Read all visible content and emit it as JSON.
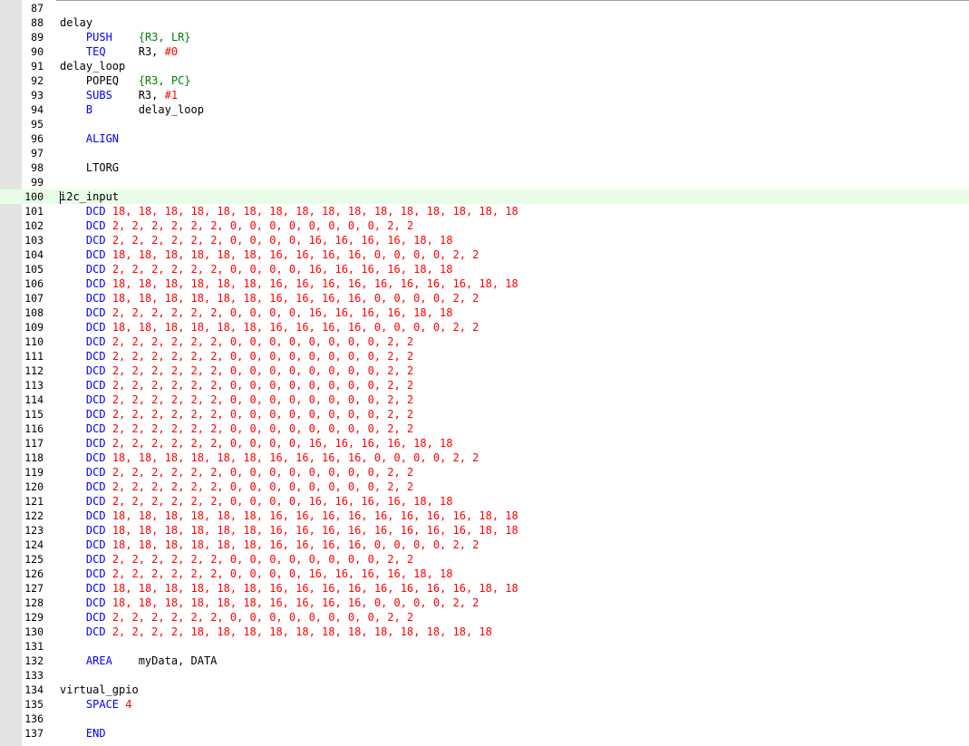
{
  "editor": {
    "current_line": 100,
    "colors": {
      "instruction": "#0000ff",
      "register": "#008000",
      "number": "#ff0000",
      "label": "#000000",
      "current_line_bg": "#e8fce8"
    },
    "lines": [
      {
        "n": "87",
        "tokens": []
      },
      {
        "n": "88",
        "tokens": [
          {
            "t": "label",
            "v": "delay"
          }
        ]
      },
      {
        "n": "89",
        "tokens": [
          {
            "t": "text",
            "v": "    "
          },
          {
            "t": "instr",
            "v": "PUSH"
          },
          {
            "t": "text",
            "v": "    "
          },
          {
            "t": "reg",
            "v": "{R3, LR}"
          }
        ]
      },
      {
        "n": "90",
        "tokens": [
          {
            "t": "text",
            "v": "    "
          },
          {
            "t": "instr",
            "v": "TEQ"
          },
          {
            "t": "text",
            "v": "     R3, "
          },
          {
            "t": "num",
            "v": "#0"
          }
        ]
      },
      {
        "n": "91",
        "tokens": [
          {
            "t": "label",
            "v": "delay_loop"
          }
        ]
      },
      {
        "n": "92",
        "tokens": [
          {
            "t": "text",
            "v": "    POPEQ   "
          },
          {
            "t": "reg",
            "v": "{R3, PC}"
          }
        ]
      },
      {
        "n": "93",
        "tokens": [
          {
            "t": "text",
            "v": "    "
          },
          {
            "t": "instr",
            "v": "SUBS"
          },
          {
            "t": "text",
            "v": "    R3, "
          },
          {
            "t": "num",
            "v": "#1"
          }
        ]
      },
      {
        "n": "94",
        "tokens": [
          {
            "t": "text",
            "v": "    "
          },
          {
            "t": "instr",
            "v": "B"
          },
          {
            "t": "text",
            "v": "       delay_loop"
          }
        ]
      },
      {
        "n": "95",
        "tokens": []
      },
      {
        "n": "96",
        "tokens": [
          {
            "t": "text",
            "v": "    "
          },
          {
            "t": "instr",
            "v": "ALIGN"
          }
        ]
      },
      {
        "n": "97",
        "tokens": []
      },
      {
        "n": "98",
        "tokens": [
          {
            "t": "text",
            "v": "    LTORG"
          }
        ]
      },
      {
        "n": "99",
        "tokens": []
      },
      {
        "n": "100",
        "tokens": [
          {
            "t": "label",
            "v": "i2c_input"
          }
        ]
      },
      {
        "n": "101",
        "tokens": [
          {
            "t": "text",
            "v": "    "
          },
          {
            "t": "instr",
            "v": "DCD"
          },
          {
            "t": "text",
            "v": " "
          },
          {
            "t": "num",
            "v": "18, 18, 18, 18, 18, 18, 18, 18, 18, 18, 18, 18, 18, 18, 18, 18"
          }
        ]
      },
      {
        "n": "102",
        "tokens": [
          {
            "t": "text",
            "v": "    "
          },
          {
            "t": "instr",
            "v": "DCD"
          },
          {
            "t": "text",
            "v": " "
          },
          {
            "t": "num",
            "v": "2, 2, 2, 2, 2, 2, 0, 0, 0, 0, 0, 0, 0, 0, 2, 2"
          }
        ]
      },
      {
        "n": "103",
        "tokens": [
          {
            "t": "text",
            "v": "    "
          },
          {
            "t": "instr",
            "v": "DCD"
          },
          {
            "t": "text",
            "v": " "
          },
          {
            "t": "num",
            "v": "2, 2, 2, 2, 2, 2, 0, 0, 0, 0, 16, 16, 16, 16, 18, 18"
          }
        ]
      },
      {
        "n": "104",
        "tokens": [
          {
            "t": "text",
            "v": "    "
          },
          {
            "t": "instr",
            "v": "DCD"
          },
          {
            "t": "text",
            "v": " "
          },
          {
            "t": "num",
            "v": "18, 18, 18, 18, 18, 18, 16, 16, 16, 16, 0, 0, 0, 0, 2, 2"
          }
        ]
      },
      {
        "n": "105",
        "tokens": [
          {
            "t": "text",
            "v": "    "
          },
          {
            "t": "instr",
            "v": "DCD"
          },
          {
            "t": "text",
            "v": " "
          },
          {
            "t": "num",
            "v": "2, 2, 2, 2, 2, 2, 0, 0, 0, 0, 16, 16, 16, 16, 18, 18"
          }
        ]
      },
      {
        "n": "106",
        "tokens": [
          {
            "t": "text",
            "v": "    "
          },
          {
            "t": "instr",
            "v": "DCD"
          },
          {
            "t": "text",
            "v": " "
          },
          {
            "t": "num",
            "v": "18, 18, 18, 18, 18, 18, 16, 16, 16, 16, 16, 16, 16, 16, 18, 18"
          }
        ]
      },
      {
        "n": "107",
        "tokens": [
          {
            "t": "text",
            "v": "    "
          },
          {
            "t": "instr",
            "v": "DCD"
          },
          {
            "t": "text",
            "v": " "
          },
          {
            "t": "num",
            "v": "18, 18, 18, 18, 18, 18, 16, 16, 16, 16, 0, 0, 0, 0, 2, 2"
          }
        ]
      },
      {
        "n": "108",
        "tokens": [
          {
            "t": "text",
            "v": "    "
          },
          {
            "t": "instr",
            "v": "DCD"
          },
          {
            "t": "text",
            "v": " "
          },
          {
            "t": "num",
            "v": "2, 2, 2, 2, 2, 2, 0, 0, 0, 0, 16, 16, 16, 16, 18, 18"
          }
        ]
      },
      {
        "n": "109",
        "tokens": [
          {
            "t": "text",
            "v": "    "
          },
          {
            "t": "instr",
            "v": "DCD"
          },
          {
            "t": "text",
            "v": " "
          },
          {
            "t": "num",
            "v": "18, 18, 18, 18, 18, 18, 16, 16, 16, 16, 0, 0, 0, 0, 2, 2"
          }
        ]
      },
      {
        "n": "110",
        "tokens": [
          {
            "t": "text",
            "v": "    "
          },
          {
            "t": "instr",
            "v": "DCD"
          },
          {
            "t": "text",
            "v": " "
          },
          {
            "t": "num",
            "v": "2, 2, 2, 2, 2, 2, 0, 0, 0, 0, 0, 0, 0, 0, 2, 2"
          }
        ]
      },
      {
        "n": "111",
        "tokens": [
          {
            "t": "text",
            "v": "    "
          },
          {
            "t": "instr",
            "v": "DCD"
          },
          {
            "t": "text",
            "v": " "
          },
          {
            "t": "num",
            "v": "2, 2, 2, 2, 2, 2, 0, 0, 0, 0, 0, 0, 0, 0, 2, 2"
          }
        ]
      },
      {
        "n": "112",
        "tokens": [
          {
            "t": "text",
            "v": "    "
          },
          {
            "t": "instr",
            "v": "DCD"
          },
          {
            "t": "text",
            "v": " "
          },
          {
            "t": "num",
            "v": "2, 2, 2, 2, 2, 2, 0, 0, 0, 0, 0, 0, 0, 0, 2, 2"
          }
        ]
      },
      {
        "n": "113",
        "tokens": [
          {
            "t": "text",
            "v": "    "
          },
          {
            "t": "instr",
            "v": "DCD"
          },
          {
            "t": "text",
            "v": " "
          },
          {
            "t": "num",
            "v": "2, 2, 2, 2, 2, 2, 0, 0, 0, 0, 0, 0, 0, 0, 2, 2"
          }
        ]
      },
      {
        "n": "114",
        "tokens": [
          {
            "t": "text",
            "v": "    "
          },
          {
            "t": "instr",
            "v": "DCD"
          },
          {
            "t": "text",
            "v": " "
          },
          {
            "t": "num",
            "v": "2, 2, 2, 2, 2, 2, 0, 0, 0, 0, 0, 0, 0, 0, 2, 2"
          }
        ]
      },
      {
        "n": "115",
        "tokens": [
          {
            "t": "text",
            "v": "    "
          },
          {
            "t": "instr",
            "v": "DCD"
          },
          {
            "t": "text",
            "v": " "
          },
          {
            "t": "num",
            "v": "2, 2, 2, 2, 2, 2, 0, 0, 0, 0, 0, 0, 0, 0, 2, 2"
          }
        ]
      },
      {
        "n": "116",
        "tokens": [
          {
            "t": "text",
            "v": "    "
          },
          {
            "t": "instr",
            "v": "DCD"
          },
          {
            "t": "text",
            "v": " "
          },
          {
            "t": "num",
            "v": "2, 2, 2, 2, 2, 2, 0, 0, 0, 0, 0, 0, 0, 0, 2, 2"
          }
        ]
      },
      {
        "n": "117",
        "tokens": [
          {
            "t": "text",
            "v": "    "
          },
          {
            "t": "instr",
            "v": "DCD"
          },
          {
            "t": "text",
            "v": " "
          },
          {
            "t": "num",
            "v": "2, 2, 2, 2, 2, 2, 0, 0, 0, 0, 16, 16, 16, 16, 18, 18"
          }
        ]
      },
      {
        "n": "118",
        "tokens": [
          {
            "t": "text",
            "v": "    "
          },
          {
            "t": "instr",
            "v": "DCD"
          },
          {
            "t": "text",
            "v": " "
          },
          {
            "t": "num",
            "v": "18, 18, 18, 18, 18, 18, 16, 16, 16, 16, 0, 0, 0, 0, 2, 2"
          }
        ]
      },
      {
        "n": "119",
        "tokens": [
          {
            "t": "text",
            "v": "    "
          },
          {
            "t": "instr",
            "v": "DCD"
          },
          {
            "t": "text",
            "v": " "
          },
          {
            "t": "num",
            "v": "2, 2, 2, 2, 2, 2, 0, 0, 0, 0, 0, 0, 0, 0, 2, 2"
          }
        ]
      },
      {
        "n": "120",
        "tokens": [
          {
            "t": "text",
            "v": "    "
          },
          {
            "t": "instr",
            "v": "DCD"
          },
          {
            "t": "text",
            "v": " "
          },
          {
            "t": "num",
            "v": "2, 2, 2, 2, 2, 2, 0, 0, 0, 0, 0, 0, 0, 0, 2, 2"
          }
        ]
      },
      {
        "n": "121",
        "tokens": [
          {
            "t": "text",
            "v": "    "
          },
          {
            "t": "instr",
            "v": "DCD"
          },
          {
            "t": "text",
            "v": " "
          },
          {
            "t": "num",
            "v": "2, 2, 2, 2, 2, 2, 0, 0, 0, 0, 16, 16, 16, 16, 18, 18"
          }
        ]
      },
      {
        "n": "122",
        "tokens": [
          {
            "t": "text",
            "v": "    "
          },
          {
            "t": "instr",
            "v": "DCD"
          },
          {
            "t": "text",
            "v": " "
          },
          {
            "t": "num",
            "v": "18, 18, 18, 18, 18, 18, 16, 16, 16, 16, 16, 16, 16, 16, 18, 18"
          }
        ]
      },
      {
        "n": "123",
        "tokens": [
          {
            "t": "text",
            "v": "    "
          },
          {
            "t": "instr",
            "v": "DCD"
          },
          {
            "t": "text",
            "v": " "
          },
          {
            "t": "num",
            "v": "18, 18, 18, 18, 18, 18, 16, 16, 16, 16, 16, 16, 16, 16, 18, 18"
          }
        ]
      },
      {
        "n": "124",
        "tokens": [
          {
            "t": "text",
            "v": "    "
          },
          {
            "t": "instr",
            "v": "DCD"
          },
          {
            "t": "text",
            "v": " "
          },
          {
            "t": "num",
            "v": "18, 18, 18, 18, 18, 18, 16, 16, 16, 16, 0, 0, 0, 0, 2, 2"
          }
        ]
      },
      {
        "n": "125",
        "tokens": [
          {
            "t": "text",
            "v": "    "
          },
          {
            "t": "instr",
            "v": "DCD"
          },
          {
            "t": "text",
            "v": " "
          },
          {
            "t": "num",
            "v": "2, 2, 2, 2, 2, 2, 0, 0, 0, 0, 0, 0, 0, 0, 2, 2"
          }
        ]
      },
      {
        "n": "126",
        "tokens": [
          {
            "t": "text",
            "v": "    "
          },
          {
            "t": "instr",
            "v": "DCD"
          },
          {
            "t": "text",
            "v": " "
          },
          {
            "t": "num",
            "v": "2, 2, 2, 2, 2, 2, 0, 0, 0, 0, 16, 16, 16, 16, 18, 18"
          }
        ]
      },
      {
        "n": "127",
        "tokens": [
          {
            "t": "text",
            "v": "    "
          },
          {
            "t": "instr",
            "v": "DCD"
          },
          {
            "t": "text",
            "v": " "
          },
          {
            "t": "num",
            "v": "18, 18, 18, 18, 18, 18, 16, 16, 16, 16, 16, 16, 16, 16, 18, 18"
          }
        ]
      },
      {
        "n": "128",
        "tokens": [
          {
            "t": "text",
            "v": "    "
          },
          {
            "t": "instr",
            "v": "DCD"
          },
          {
            "t": "text",
            "v": " "
          },
          {
            "t": "num",
            "v": "18, 18, 18, 18, 18, 18, 16, 16, 16, 16, 0, 0, 0, 0, 2, 2"
          }
        ]
      },
      {
        "n": "129",
        "tokens": [
          {
            "t": "text",
            "v": "    "
          },
          {
            "t": "instr",
            "v": "DCD"
          },
          {
            "t": "text",
            "v": " "
          },
          {
            "t": "num",
            "v": "2, 2, 2, 2, 2, 2, 0, 0, 0, 0, 0, 0, 0, 0, 2, 2"
          }
        ]
      },
      {
        "n": "130",
        "tokens": [
          {
            "t": "text",
            "v": "    "
          },
          {
            "t": "instr",
            "v": "DCD"
          },
          {
            "t": "text",
            "v": " "
          },
          {
            "t": "num",
            "v": "2, 2, 2, 2, 18, 18, 18, 18, 18, 18, 18, 18, 18, 18, 18, 18"
          }
        ]
      },
      {
        "n": "131",
        "tokens": []
      },
      {
        "n": "132",
        "tokens": [
          {
            "t": "text",
            "v": "    "
          },
          {
            "t": "instr",
            "v": "AREA"
          },
          {
            "t": "text",
            "v": "    myData, DATA"
          }
        ]
      },
      {
        "n": "133",
        "tokens": []
      },
      {
        "n": "134",
        "tokens": [
          {
            "t": "label",
            "v": "virtual_gpio"
          }
        ]
      },
      {
        "n": "135",
        "tokens": [
          {
            "t": "text",
            "v": "    "
          },
          {
            "t": "instr",
            "v": "SPACE"
          },
          {
            "t": "text",
            "v": " "
          },
          {
            "t": "num",
            "v": "4"
          }
        ]
      },
      {
        "n": "136",
        "tokens": []
      },
      {
        "n": "137",
        "tokens": [
          {
            "t": "text",
            "v": "    "
          },
          {
            "t": "instr",
            "v": "END"
          }
        ]
      }
    ]
  }
}
